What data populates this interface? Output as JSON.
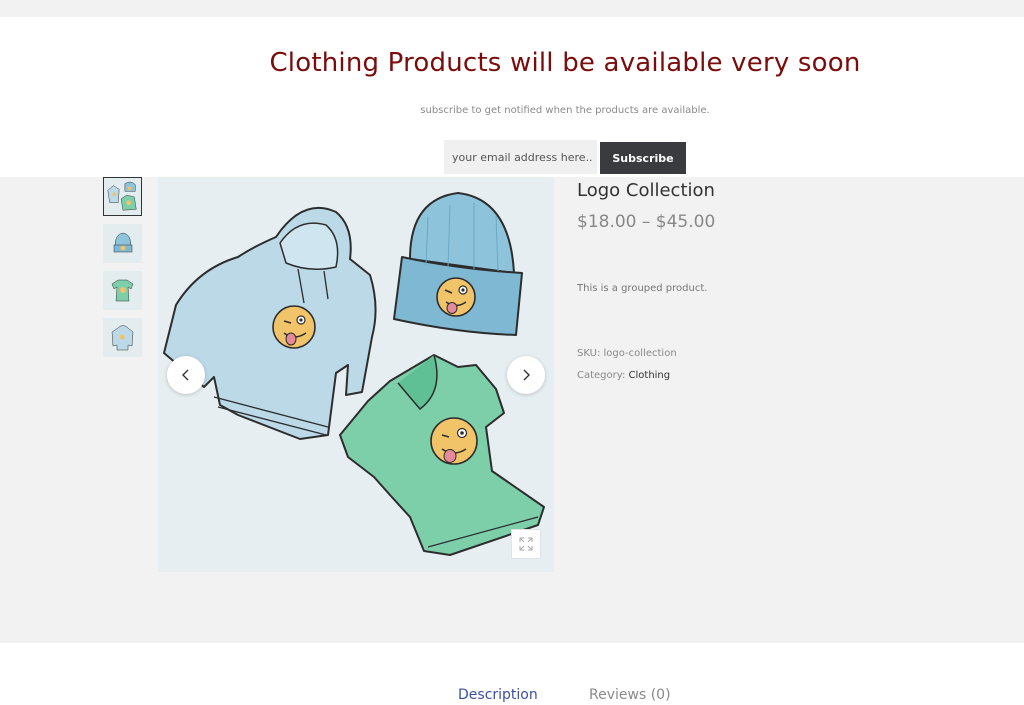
{
  "notice": {
    "title": "Clothing Products will be available very soon",
    "subtitle": "subscribe to get notified when the products are available.",
    "email_placeholder": "your email address here..",
    "subscribe_label": "Subscribe"
  },
  "product": {
    "title": "Logo Collection",
    "price": "$18.00 – $45.00",
    "short_description": "This is a grouped product.",
    "sku_label": "SKU:",
    "sku_value": "logo-collection",
    "category_label": "Category:",
    "category_value": "Clothing"
  },
  "gallery": {
    "thumbnails": [
      "logo-collection",
      "beanie",
      "t-shirt",
      "hoodie"
    ],
    "active_index": 0
  },
  "tabs": [
    {
      "label": "Description",
      "active": true
    },
    {
      "label": "Reviews (0)",
      "active": false
    }
  ],
  "colors": {
    "title": "#7a0c0c",
    "button_bg": "#3a3b3f",
    "active_tab": "#3b4fa0",
    "hoodie": "#bcd9e8",
    "beanie": "#8ec4db",
    "tshirt": "#7ccfa9",
    "emoji": "#f2c46a"
  },
  "icons": {
    "prev": "chevron-left-icon",
    "next": "chevron-right-icon",
    "zoom": "expand-icon"
  }
}
